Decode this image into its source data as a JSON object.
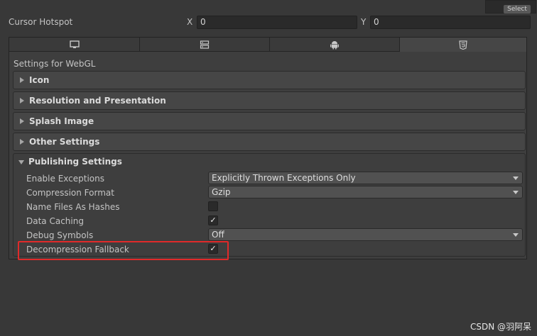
{
  "top": {
    "select_label": "Select"
  },
  "cursor_hotspot": {
    "label": "Cursor Hotspot",
    "x_label": "X",
    "x_value": "0",
    "y_label": "Y",
    "y_value": "0"
  },
  "tabs": [
    {
      "icon": "monitor-icon",
      "active": false
    },
    {
      "icon": "server-icon",
      "active": false
    },
    {
      "icon": "android-icon",
      "active": false
    },
    {
      "icon": "html5-icon",
      "active": true
    }
  ],
  "settings_for": "Settings for WebGL",
  "sections": {
    "icon": "Icon",
    "resolution": "Resolution and Presentation",
    "splash": "Splash Image",
    "other": "Other Settings",
    "publishing": "Publishing Settings"
  },
  "publishing": {
    "enable_exceptions": {
      "label": "Enable Exceptions",
      "value": "Explicitly Thrown Exceptions Only"
    },
    "compression_format": {
      "label": "Compression Format",
      "value": "Gzip"
    },
    "name_files_as_hashes": {
      "label": "Name Files As Hashes",
      "checked": false,
      "mark": ""
    },
    "data_caching": {
      "label": "Data Caching",
      "checked": true,
      "mark": "✓"
    },
    "debug_symbols": {
      "label": "Debug Symbols",
      "value": "Off"
    },
    "decompression_fallback": {
      "label": "Decompression Fallback",
      "checked": true,
      "mark": "✓"
    }
  },
  "highlight_color": "#e02a2a",
  "watermark": "CSDN @羽阿呆"
}
